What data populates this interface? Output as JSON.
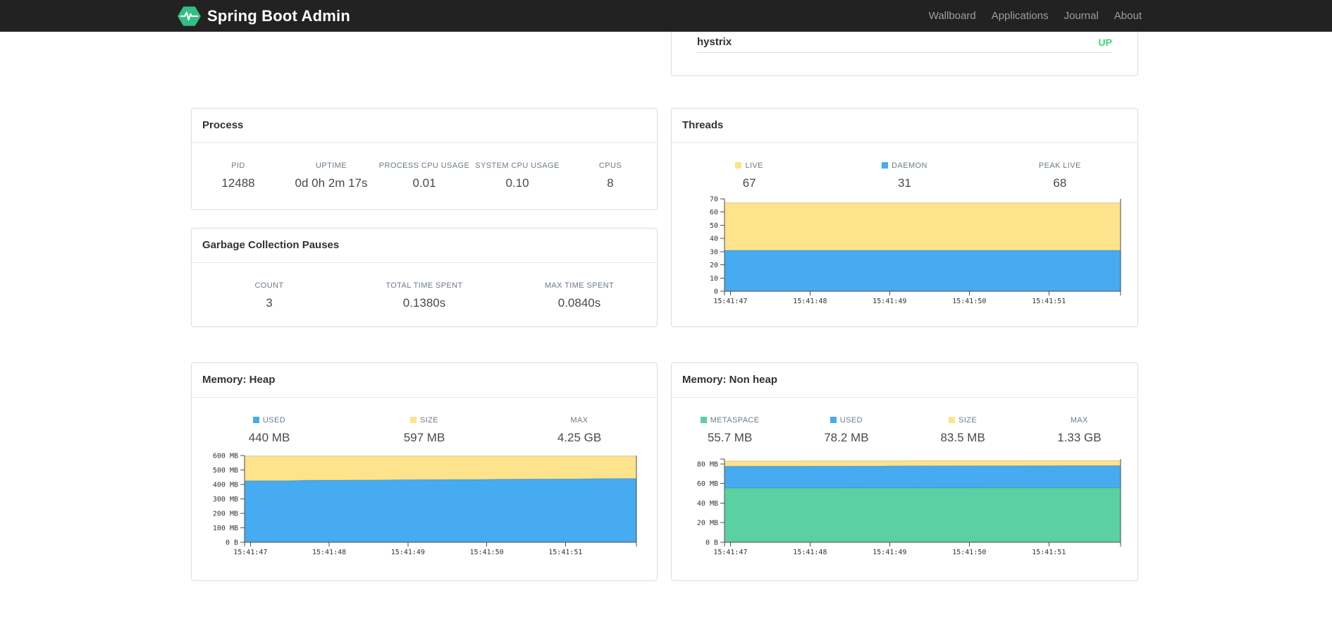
{
  "navbar": {
    "brand": "Spring Boot Admin",
    "items": [
      {
        "label": "Wallboard"
      },
      {
        "label": "Applications"
      },
      {
        "label": "Journal"
      },
      {
        "label": "About"
      }
    ]
  },
  "status_card": {
    "app_name": "hystrix",
    "status": "UP"
  },
  "colors": {
    "navbar_bg": "#222222",
    "logo_green": "#32BE85",
    "status_up_green": "#41D87B",
    "chart_yellow": "#FDE38B",
    "chart_blue": "#46ABF0",
    "chart_green": "#5BD0A2"
  },
  "panels": {
    "process": {
      "title": "Process",
      "stats": [
        {
          "label": "PID",
          "value": "12488"
        },
        {
          "label": "UPTIME",
          "value": "0d 0h 2m 17s"
        },
        {
          "label": "PROCESS CPU USAGE",
          "value": "0.01"
        },
        {
          "label": "SYSTEM CPU USAGE",
          "value": "0.10"
        },
        {
          "label": "CPUS",
          "value": "8"
        }
      ]
    },
    "gc": {
      "title": "Garbage Collection Pauses",
      "stats": [
        {
          "label": "COUNT",
          "value": "3"
        },
        {
          "label": "TOTAL TIME SPENT",
          "value": "0.1380s"
        },
        {
          "label": "MAX TIME SPENT",
          "value": "0.0840s"
        }
      ]
    },
    "threads": {
      "title": "Threads",
      "stats": [
        {
          "label": "LIVE",
          "value": "67",
          "color": "#FDE38B"
        },
        {
          "label": "DAEMON",
          "value": "31",
          "color": "#46ABF0"
        },
        {
          "label": "PEAK LIVE",
          "value": "68"
        }
      ]
    },
    "heap": {
      "title": "Memory: Heap",
      "stats": [
        {
          "label": "USED",
          "value": "440 MB",
          "color": "#46ABF0"
        },
        {
          "label": "SIZE",
          "value": "597 MB",
          "color": "#FDE38B"
        },
        {
          "label": "MAX",
          "value": "4.25 GB"
        }
      ]
    },
    "nonheap": {
      "title": "Memory: Non heap",
      "stats": [
        {
          "label": "METASPACE",
          "value": "55.7 MB",
          "color": "#5BD0A2"
        },
        {
          "label": "USED",
          "value": "78.2 MB",
          "color": "#46ABF0"
        },
        {
          "label": "SIZE",
          "value": "83.5 MB",
          "color": "#FDE38B"
        },
        {
          "label": "MAX",
          "value": "1.33 GB"
        }
      ]
    }
  },
  "chart_data": [
    {
      "id": "threads",
      "type": "area",
      "title": "Threads",
      "x_labels": [
        "15:41:47",
        "15:41:48",
        "15:41:49",
        "15:41:50",
        "15:41:51"
      ],
      "x_tick_pos": [
        0.015,
        0.216,
        0.417,
        0.618,
        0.819
      ],
      "ylim": [
        0,
        70
      ],
      "yticks": [
        {
          "v": 0,
          "label": "0"
        },
        {
          "v": 10,
          "label": "10"
        },
        {
          "v": 20,
          "label": "20"
        },
        {
          "v": 30,
          "label": "30"
        },
        {
          "v": 40,
          "label": "40"
        },
        {
          "v": 50,
          "label": "50"
        },
        {
          "v": 60,
          "label": "60"
        },
        {
          "v": 70,
          "label": "70"
        }
      ],
      "legend_position": "top",
      "grid": false,
      "series": [
        {
          "name": "LIVE",
          "color": "#FDE38B",
          "points": [
            [
              0,
              67
            ],
            [
              1,
              67
            ]
          ]
        },
        {
          "name": "DAEMON",
          "color": "#46ABF0",
          "points": [
            [
              0,
              31
            ],
            [
              1,
              31
            ]
          ]
        }
      ]
    },
    {
      "id": "heap",
      "type": "area",
      "title": "Memory: Heap",
      "x_labels": [
        "15:41:47",
        "15:41:48",
        "15:41:49",
        "15:41:50",
        "15:41:51"
      ],
      "x_tick_pos": [
        0.015,
        0.216,
        0.417,
        0.618,
        0.819
      ],
      "ylim": [
        0,
        600
      ],
      "yticks": [
        {
          "v": 0,
          "label": "0 B"
        },
        {
          "v": 100,
          "label": "100 MB"
        },
        {
          "v": 200,
          "label": "200 MB"
        },
        {
          "v": 300,
          "label": "300 MB"
        },
        {
          "v": 400,
          "label": "400 MB"
        },
        {
          "v": 500,
          "label": "500 MB"
        },
        {
          "v": 600,
          "label": "600 MB"
        }
      ],
      "legend_position": "top",
      "grid": false,
      "series": [
        {
          "name": "SIZE",
          "color": "#FDE38B",
          "points": [
            [
              0,
              597
            ],
            [
              1,
              597
            ]
          ]
        },
        {
          "name": "USED",
          "color": "#46ABF0",
          "points": [
            [
              0,
              425
            ],
            [
              0.12,
              426
            ],
            [
              0.15,
              429
            ],
            [
              0.35,
              430
            ],
            [
              0.4,
              432
            ],
            [
              0.6,
              434
            ],
            [
              0.65,
              436
            ],
            [
              0.85,
              438
            ],
            [
              0.9,
              440
            ],
            [
              1,
              441
            ]
          ]
        }
      ]
    },
    {
      "id": "nonheap",
      "type": "area",
      "title": "Memory: Non heap",
      "x_labels": [
        "15:41:47",
        "15:41:48",
        "15:41:49",
        "15:41:50",
        "15:41:51"
      ],
      "x_tick_pos": [
        0.015,
        0.216,
        0.417,
        0.618,
        0.819
      ],
      "ylim": [
        0,
        85
      ],
      "yticks": [
        {
          "v": 0,
          "label": "0 B"
        },
        {
          "v": 20,
          "label": "20 MB"
        },
        {
          "v": 40,
          "label": "40 MB"
        },
        {
          "v": 60,
          "label": "60 MB"
        },
        {
          "v": 80,
          "label": "80 MB"
        }
      ],
      "legend_position": "top",
      "grid": false,
      "series": [
        {
          "name": "SIZE",
          "color": "#FDE38B",
          "points": [
            [
              0,
              82.9
            ],
            [
              0.18,
              82.9
            ],
            [
              0.2,
              83.1
            ],
            [
              0.45,
              83.1
            ],
            [
              0.47,
              83.3
            ],
            [
              0.75,
              83.3
            ],
            [
              0.77,
              83.5
            ],
            [
              1,
              83.5
            ]
          ]
        },
        {
          "name": "USED",
          "color": "#46ABF0",
          "points": [
            [
              0,
              77.6
            ],
            [
              0.4,
              77.8
            ],
            [
              0.42,
              78.0
            ],
            [
              1,
              78.2
            ]
          ]
        },
        {
          "name": "METASPACE",
          "color": "#5BD0A2",
          "points": [
            [
              0,
              55.5
            ],
            [
              1,
              55.7
            ]
          ]
        }
      ]
    }
  ]
}
